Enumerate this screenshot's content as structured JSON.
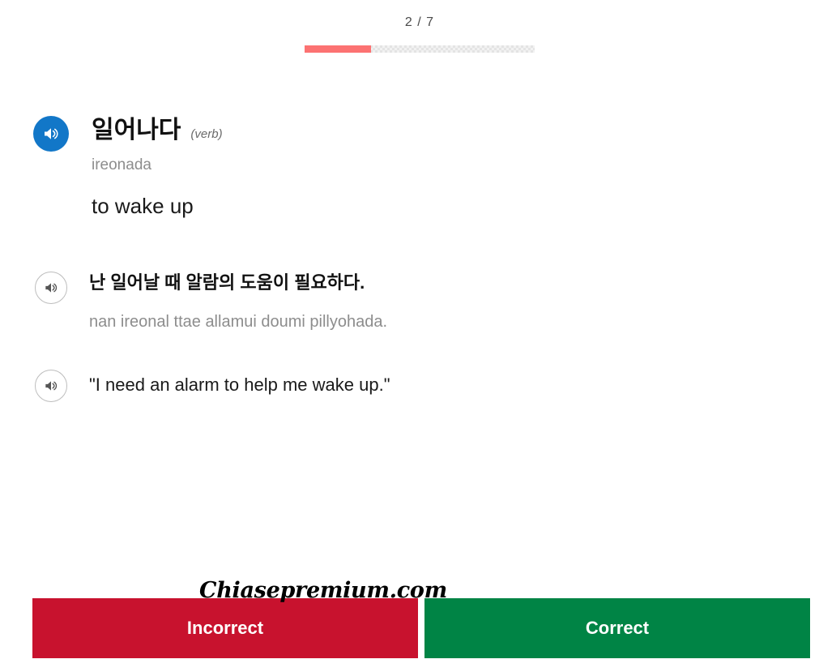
{
  "progress": {
    "counter": "2 / 7",
    "current": 2,
    "total": 7,
    "fill_percent": 29,
    "fill_color": "#fc7272",
    "track_color": "#e4e4e4"
  },
  "card": {
    "headword": "일어나다",
    "part_of_speech": "(verb)",
    "romanization": "ireonada",
    "meaning": "to wake up",
    "audio_icon": "speaker-icon",
    "audio_button_color": "#1277c8",
    "example": {
      "sentence": "난 일어날 때 알람의 도움이 필요하다.",
      "sentence_romanization": "nan ireonal ttae allamui doumi pillyohada.",
      "translation": "\"I need an alarm to help me wake up.\"",
      "sentence_audio_icon": "speaker-icon",
      "translation_audio_icon": "speaker-icon"
    }
  },
  "watermark": {
    "text": "Chiasepremium.com"
  },
  "answers": {
    "incorrect_label": "Incorrect",
    "correct_label": "Correct",
    "incorrect_color": "#c8122e",
    "correct_color": "#008445"
  }
}
